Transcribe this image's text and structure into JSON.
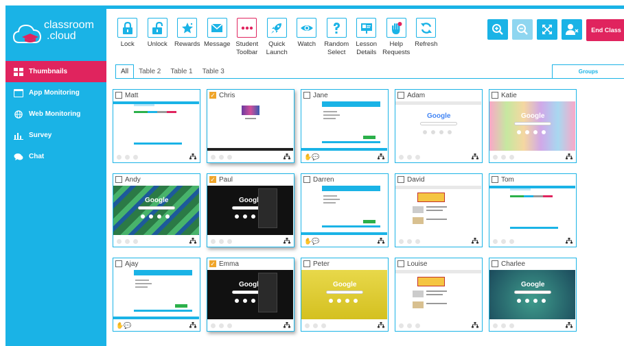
{
  "brand": {
    "line1": "classroom",
    "line2": ".cloud"
  },
  "sidebar": {
    "items": [
      {
        "label": "Thumbnails",
        "icon": "grid-icon",
        "active": true
      },
      {
        "label": "App Monitoring",
        "icon": "window-icon"
      },
      {
        "label": "Web Monitoring",
        "icon": "globe-icon"
      },
      {
        "label": "Survey",
        "icon": "bar-chart-icon"
      },
      {
        "label": "Chat",
        "icon": "chat-icon"
      }
    ]
  },
  "toolbar": {
    "tools": [
      {
        "l1": "Lock",
        "l2": "",
        "icon": "lock-icon"
      },
      {
        "l1": "Unlock",
        "l2": "",
        "icon": "unlock-icon"
      },
      {
        "l1": "Rewards",
        "l2": "",
        "icon": "star-icon"
      },
      {
        "l1": "Message",
        "l2": "",
        "icon": "envelope-icon"
      },
      {
        "l1": "Student",
        "l2": "Toolbar",
        "icon": "dots-icon"
      },
      {
        "l1": "Quick",
        "l2": "Launch",
        "icon": "rocket-icon"
      },
      {
        "l1": "Watch",
        "l2": "",
        "icon": "eye-icon"
      },
      {
        "l1": "Random",
        "l2": "Select",
        "icon": "question-icon"
      },
      {
        "l1": "Lesson",
        "l2": "Details",
        "icon": "presentation-icon"
      },
      {
        "l1": "Help",
        "l2": "Requests",
        "icon": "hand-icon"
      },
      {
        "l1": "Refresh",
        "l2": "",
        "icon": "refresh-icon"
      }
    ],
    "end_class": "End Class"
  },
  "tabs": [
    "All",
    "Table 2",
    "Table 1",
    "Table 3"
  ],
  "groups_label": "Groups",
  "google_label": "Google",
  "colors": {
    "accent": "#1ab3e6",
    "pink": "#e0245e",
    "check": "#f0a52a"
  },
  "students": [
    {
      "name": "Matt",
      "checked": false,
      "screen": "chat"
    },
    {
      "name": "Chris",
      "checked": true,
      "screen": "art"
    },
    {
      "name": "Jane",
      "checked": false,
      "screen": "chat2"
    },
    {
      "name": "Adam",
      "checked": false,
      "screen": "google-white"
    },
    {
      "name": "Katie",
      "checked": false,
      "screen": "google-rainbow"
    },
    {
      "name": "Andy",
      "checked": false,
      "screen": "google-green"
    },
    {
      "name": "Paul",
      "checked": true,
      "screen": "google-dark"
    },
    {
      "name": "Darren",
      "checked": false,
      "screen": "chat2"
    },
    {
      "name": "David",
      "checked": false,
      "screen": "doodle"
    },
    {
      "name": "Tom",
      "checked": false,
      "screen": "chat"
    },
    {
      "name": "Ajay",
      "checked": false,
      "screen": "chat2"
    },
    {
      "name": "Emma",
      "checked": true,
      "screen": "google-dark"
    },
    {
      "name": "Peter",
      "checked": false,
      "screen": "google-yellow"
    },
    {
      "name": "Louise",
      "checked": false,
      "screen": "doodle"
    },
    {
      "name": "Charlee",
      "checked": false,
      "screen": "google-ocean"
    }
  ]
}
